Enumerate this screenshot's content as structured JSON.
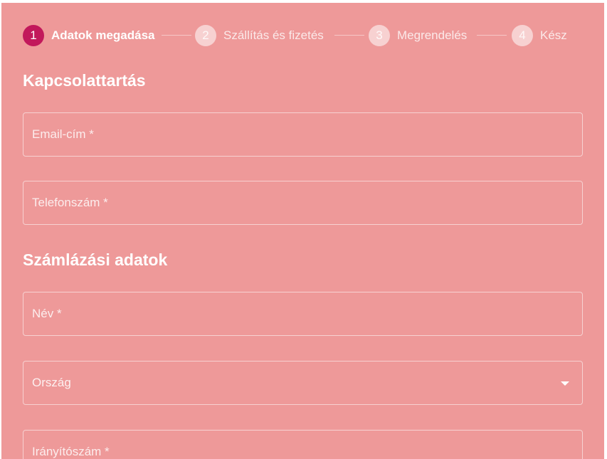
{
  "stepper": {
    "steps": [
      {
        "number": "1",
        "label": "Adatok megadása",
        "state": "active"
      },
      {
        "number": "2",
        "label": "Szállítás és fizetés",
        "state": "inactive"
      },
      {
        "number": "3",
        "label": "Megrendelés",
        "state": "inactive"
      },
      {
        "number": "4",
        "label": "Kész",
        "state": "inactive"
      }
    ]
  },
  "contact": {
    "title": "Kapcsolattartás",
    "email_placeholder": "Email-cím *",
    "phone_placeholder": "Telefonszám *"
  },
  "billing": {
    "title": "Számlázási adatok",
    "name_placeholder": "Név *",
    "country_label": "Ország",
    "zip_placeholder": "Irányítószám *"
  },
  "colors": {
    "background": "#ee9999",
    "active_step": "#c2185b",
    "text": "#ffffff"
  },
  "icons": {
    "country_dropdown": "chevron-down-icon"
  }
}
